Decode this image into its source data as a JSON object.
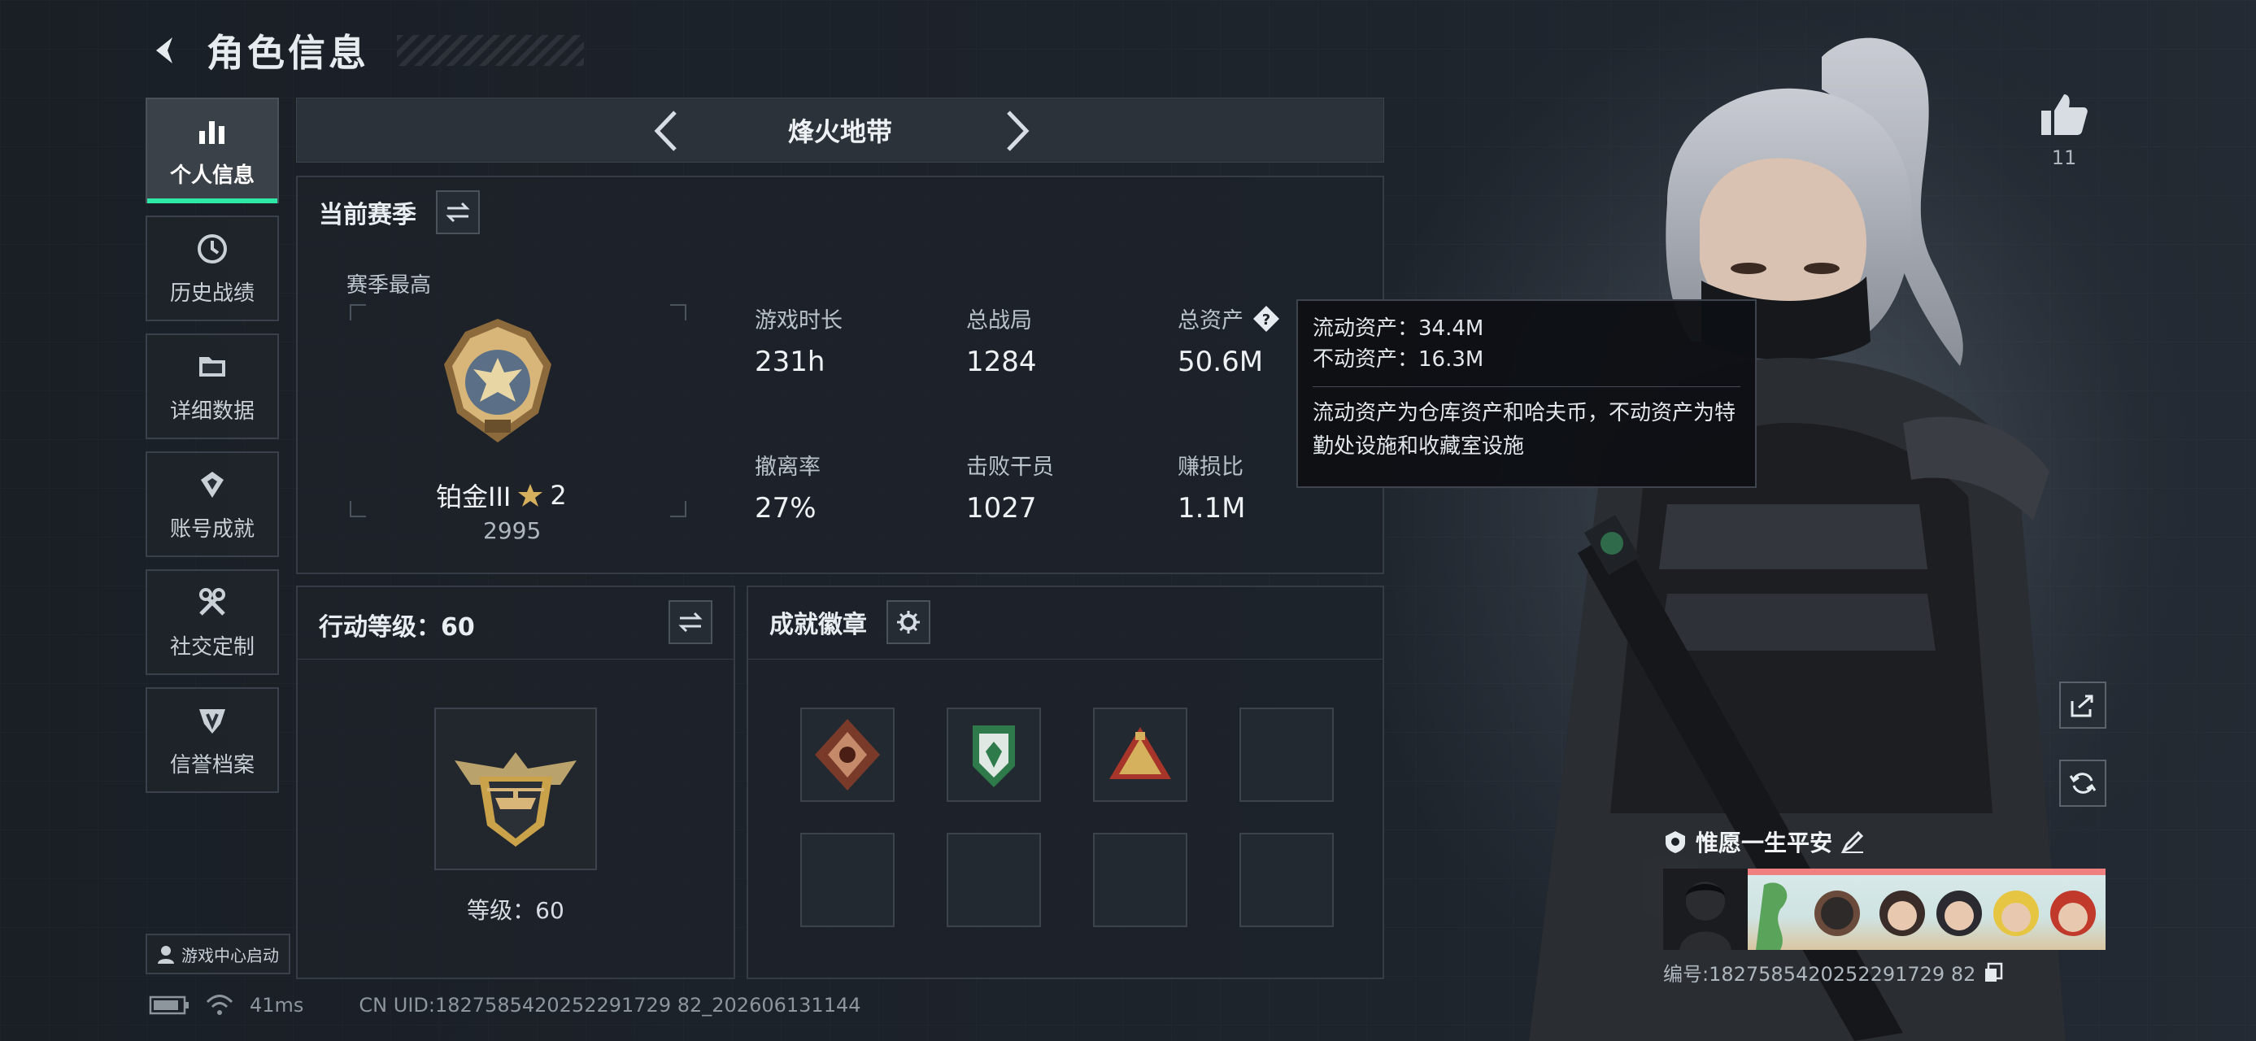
{
  "header": {
    "title": "角色信息"
  },
  "nav": {
    "items": [
      {
        "label": "个人信息",
        "icon": "bar-chart-icon",
        "active": true
      },
      {
        "label": "历史战绩",
        "icon": "clock-icon"
      },
      {
        "label": "详细数据",
        "icon": "folder-icon"
      },
      {
        "label": "账号成就",
        "icon": "achievement-icon"
      },
      {
        "label": "社交定制",
        "icon": "tools-icon"
      },
      {
        "label": "信誉档案",
        "icon": "shield-icon"
      }
    ],
    "game_center": "游戏中心启动"
  },
  "mode": {
    "name": "烽火地带"
  },
  "current_season": {
    "title": "当前赛季",
    "best_label": "赛季最高",
    "rank_name": "铂金III",
    "rank_stars": "2",
    "rank_points": "2995",
    "stats": [
      {
        "label": "游戏时长",
        "value": "231h"
      },
      {
        "label": "总战局",
        "value": "1284"
      },
      {
        "label": "总资产",
        "value": "50.6M"
      },
      {
        "label": "撤离率",
        "value": "27%"
      },
      {
        "label": "击败干员",
        "value": "1027"
      },
      {
        "label": "赚损比",
        "value": "1.1M"
      }
    ]
  },
  "assets_tooltip": {
    "liquid": "流动资产：34.4M",
    "fixed": "不动资产：16.3M",
    "description": "流动资产为仓库资产和哈夫币，不动资产为特勤处设施和收藏室设施"
  },
  "action_level": {
    "title": "行动等级：60",
    "level_text": "等级：60"
  },
  "achievements": {
    "title": "成就徽章",
    "badges": [
      "dragon-badge",
      "green-shield-badge",
      "gold-emblem-badge",
      "",
      "",
      "",
      "",
      ""
    ]
  },
  "likes": {
    "count": "11"
  },
  "player": {
    "name": "惟愿一生平安",
    "id": "编号:1827585420252291729 82"
  },
  "status": {
    "ping": "41ms",
    "uid": "CN UID:1827585420252291729 82_202606131144"
  },
  "colors": {
    "accent": "#2ee8a6",
    "gold": "#c9a24a"
  }
}
